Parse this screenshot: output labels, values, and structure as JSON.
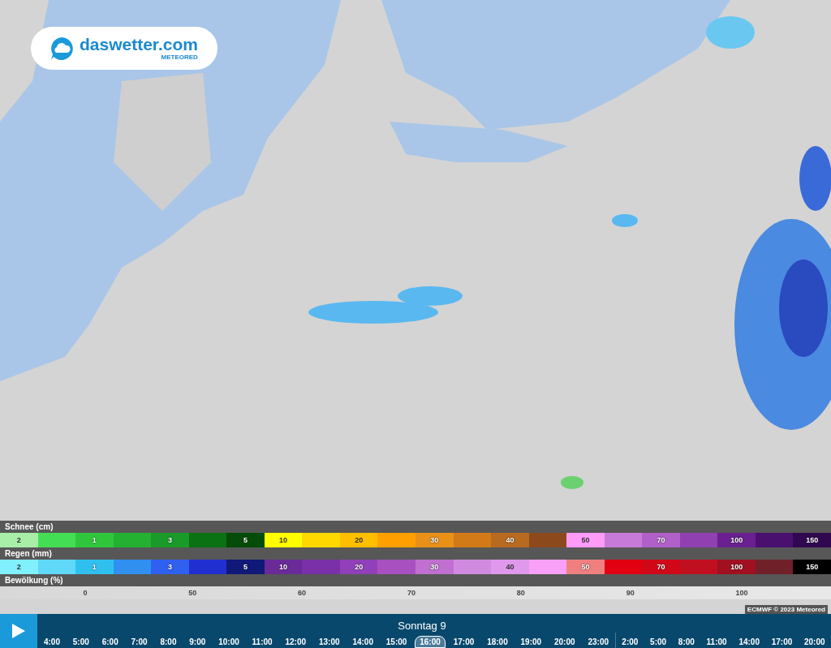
{
  "logo": {
    "name": "daswetter.com",
    "tagline": "METEORED"
  },
  "legend": [
    {
      "title": "Schnee (cm)",
      "kind": "scale",
      "cells": [
        {
          "color": "#a8eea8",
          "label": "2"
        },
        {
          "color": "#44de55"
        },
        {
          "color": "#30c63c",
          "label": "1"
        },
        {
          "color": "#24b030"
        },
        {
          "color": "#1a9a28",
          "label": "3"
        },
        {
          "color": "#0a7212"
        },
        {
          "color": "#044c08",
          "label": "5"
        },
        {
          "color": "#ffff00",
          "label": "10"
        },
        {
          "color": "#ffd800"
        },
        {
          "color": "#ffbe00",
          "label": "20"
        },
        {
          "color": "#ffa000"
        },
        {
          "color": "#e89018",
          "label": "30"
        },
        {
          "color": "#d27a18"
        },
        {
          "color": "#b86a20",
          "label": "40"
        },
        {
          "color": "#8c4a1c"
        },
        {
          "color": "#ff9cf8",
          "label": "50"
        },
        {
          "color": "#c87ad8"
        },
        {
          "color": "#b060c8",
          "label": "70"
        },
        {
          "color": "#9040b0"
        },
        {
          "color": "#6a2090",
          "label": "100"
        },
        {
          "color": "#4a1070"
        },
        {
          "color": "#300850",
          "label": "150"
        }
      ]
    },
    {
      "title": "Regen (mm)",
      "kind": "scale",
      "cells": [
        {
          "color": "#80f0ff",
          "label": "2"
        },
        {
          "color": "#60d8f8"
        },
        {
          "color": "#30c0f0",
          "label": "1"
        },
        {
          "color": "#3090f0"
        },
        {
          "color": "#3060f0",
          "label": "3"
        },
        {
          "color": "#2030d0"
        },
        {
          "color": "#101878",
          "label": "5"
        },
        {
          "color": "#6a2a98",
          "label": "10"
        },
        {
          "color": "#7a30a8"
        },
        {
          "color": "#9040b8",
          "label": "20"
        },
        {
          "color": "#a850c0"
        },
        {
          "color": "#c070d0",
          "label": "30"
        },
        {
          "color": "#d08ae0"
        },
        {
          "color": "#e098ec",
          "label": "40"
        },
        {
          "color": "#f8a0f8"
        },
        {
          "color": "#f08080",
          "label": "50"
        },
        {
          "color": "#e00010"
        },
        {
          "color": "#d00818",
          "label": "70"
        },
        {
          "color": "#c01020"
        },
        {
          "color": "#a01020",
          "label": "100"
        },
        {
          "color": "#702028"
        },
        {
          "color": "#000000",
          "label": "150"
        }
      ]
    },
    {
      "title": "Bewölkung (%)",
      "kind": "gradient",
      "ticks": [
        "0",
        "50",
        "60",
        "70",
        "80",
        "90",
        "100"
      ]
    }
  ],
  "copyright": "ECMWF © 2023 Meteored",
  "timeline": {
    "day_label": "Sonntag 9",
    "groups": [
      {
        "hours": [
          {
            "label": "4:00",
            "selected": false
          },
          {
            "label": "5:00",
            "selected": false
          },
          {
            "label": "6:00",
            "selected": false
          },
          {
            "label": "7:00",
            "selected": false
          },
          {
            "label": "8:00",
            "selected": false
          },
          {
            "label": "9:00",
            "selected": false
          },
          {
            "label": "10:00",
            "selected": false
          },
          {
            "label": "11:00",
            "selected": false
          },
          {
            "label": "12:00",
            "selected": false
          },
          {
            "label": "13:00",
            "selected": false
          },
          {
            "label": "14:00",
            "selected": false
          },
          {
            "label": "15:00",
            "selected": false
          },
          {
            "label": "16:00",
            "selected": true
          },
          {
            "label": "17:00",
            "selected": false
          },
          {
            "label": "18:00",
            "selected": false
          },
          {
            "label": "19:00",
            "selected": false
          },
          {
            "label": "20:00",
            "selected": false
          },
          {
            "label": "23:00",
            "selected": false
          }
        ]
      },
      {
        "hours": [
          {
            "label": "2:00",
            "selected": false
          },
          {
            "label": "5:00",
            "selected": false
          },
          {
            "label": "8:00",
            "selected": false
          },
          {
            "label": "11:00",
            "selected": false
          },
          {
            "label": "14:00",
            "selected": false
          },
          {
            "label": "17:00",
            "selected": false
          },
          {
            "label": "20:00",
            "selected": false
          }
        ]
      }
    ]
  }
}
